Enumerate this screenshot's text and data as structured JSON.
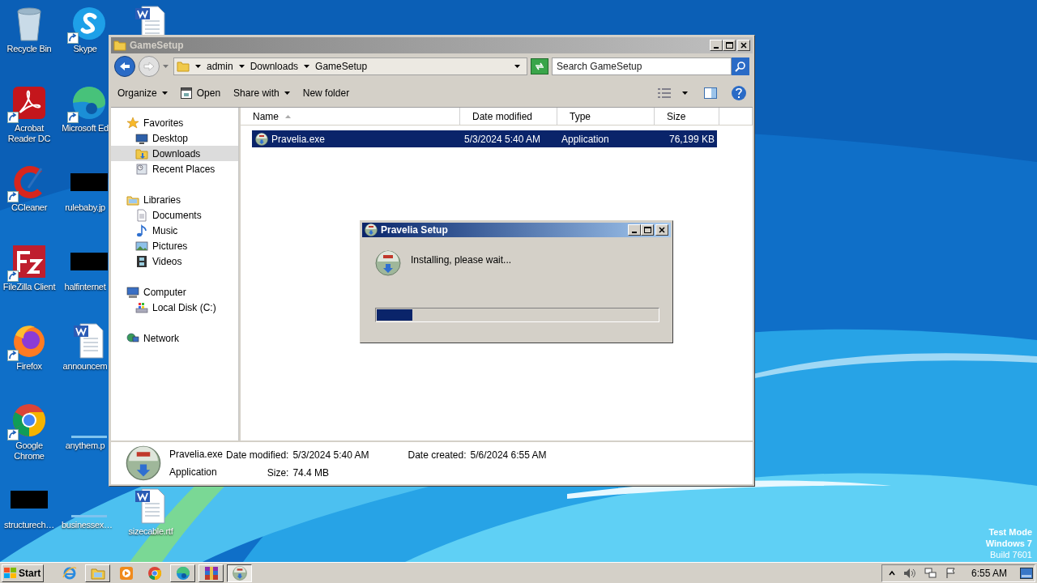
{
  "desktop": {
    "columns": [
      [
        {
          "label": "Recycle Bin",
          "kind": "recycle",
          "shortcut": false
        },
        {
          "label": "Acrobat Reader DC",
          "kind": "acrobat",
          "shortcut": true
        },
        {
          "label": "CCleaner",
          "kind": "ccleaner",
          "shortcut": true
        },
        {
          "label": "FileZilla Client",
          "kind": "filezilla",
          "shortcut": true
        },
        {
          "label": "Firefox",
          "kind": "firefox",
          "shortcut": true
        },
        {
          "label": "Google Chrome",
          "kind": "chrome",
          "shortcut": true
        },
        {
          "label": "structurech…",
          "kind": "redacted",
          "shortcut": false
        }
      ],
      [
        {
          "label": "Skype",
          "kind": "skype",
          "shortcut": true
        },
        {
          "label": "Microsoft Ed",
          "kind": "edge",
          "shortcut": true
        },
        {
          "label": "rulebaby.jp",
          "kind": "redacted",
          "shortcut": false
        },
        {
          "label": "halfinternet",
          "kind": "redacted",
          "shortcut": false
        },
        {
          "label": "announcem",
          "kind": "word",
          "shortcut": false
        },
        {
          "label": "anythem.p",
          "kind": "blank",
          "shortcut": false
        },
        {
          "label": "businessex…",
          "kind": "blank",
          "shortcut": false
        }
      ],
      [
        {
          "kind": "word",
          "shortcut": false
        },
        {
          "label": "sizecable.rtf",
          "kind": "word",
          "shortcut": false
        }
      ]
    ],
    "watermark": [
      "Test Mode",
      "Windows 7",
      "Build 7601"
    ]
  },
  "explorer": {
    "title": "GameSetup",
    "active": false,
    "address": {
      "path": [
        "admin",
        "Downloads",
        "GameSetup"
      ]
    },
    "search": {
      "placeholder": "Search GameSetup"
    },
    "toolbar": [
      {
        "label": "Organize",
        "kind": "menu"
      },
      {
        "label": "Open",
        "kind": "open"
      },
      {
        "label": "Share with",
        "kind": "menu"
      },
      {
        "label": "New folder",
        "kind": "plain"
      }
    ],
    "nav": [
      {
        "label": "Favorites",
        "kind": "star",
        "selected": false,
        "children": [
          {
            "label": "Desktop",
            "kind": "desktop",
            "selected": false
          },
          {
            "label": "Downloads",
            "kind": "downloads",
            "selected": true
          },
          {
            "label": "Recent Places",
            "kind": "recent",
            "selected": false
          }
        ]
      },
      {
        "label": "Libraries",
        "kind": "library",
        "selected": false,
        "children": [
          {
            "label": "Documents",
            "kind": "documents",
            "selected": false
          },
          {
            "label": "Music",
            "kind": "music",
            "selected": false
          },
          {
            "label": "Pictures",
            "kind": "pictures",
            "selected": false
          },
          {
            "label": "Videos",
            "kind": "videos",
            "selected": false
          }
        ]
      },
      {
        "label": "Computer",
        "kind": "computer",
        "selected": false,
        "children": [
          {
            "label": "Local Disk (C:)",
            "kind": "drive",
            "selected": false
          }
        ]
      },
      {
        "label": "Network",
        "kind": "network",
        "selected": false
      }
    ],
    "columns": [
      {
        "label": "Name",
        "sorted": true
      },
      {
        "label": "Date modified",
        "sorted": false
      },
      {
        "label": "Type",
        "sorted": false
      },
      {
        "label": "Size",
        "sorted": false
      }
    ],
    "files": [
      {
        "name": "Pravelia.exe",
        "date_modified": "5/3/2024 5:40 AM",
        "type": "Application",
        "size": "76,199 KB",
        "selected": true
      }
    ],
    "details": {
      "name": "Pravelia.exe",
      "type": "Application",
      "field_groups": [
        [
          {
            "label": "Date modified:",
            "value": "5/3/2024 5:40 AM"
          },
          {
            "label": "Size:",
            "value": "74.4 MB"
          }
        ],
        [
          {
            "label": "Date created:",
            "value": "5/6/2024 6:55 AM"
          }
        ]
      ]
    }
  },
  "dialog": {
    "title": "Pravelia Setup",
    "active": true,
    "message": "Installing, please wait...",
    "progress": {
      "level": 0.126
    }
  },
  "taskbar": {
    "start": "Start",
    "apps": [
      {
        "kind": "ie",
        "running": false,
        "selected": false
      },
      {
        "kind": "folder",
        "running": true,
        "selected": false
      },
      {
        "kind": "media",
        "running": false,
        "selected": false
      },
      {
        "kind": "chrome",
        "running": false,
        "selected": false
      },
      {
        "kind": "edge",
        "running": true,
        "selected": false
      },
      {
        "kind": "winrar",
        "running": true,
        "selected": false
      },
      {
        "kind": "setup",
        "running": true,
        "selected": true
      }
    ],
    "clock": "6:55 AM"
  }
}
